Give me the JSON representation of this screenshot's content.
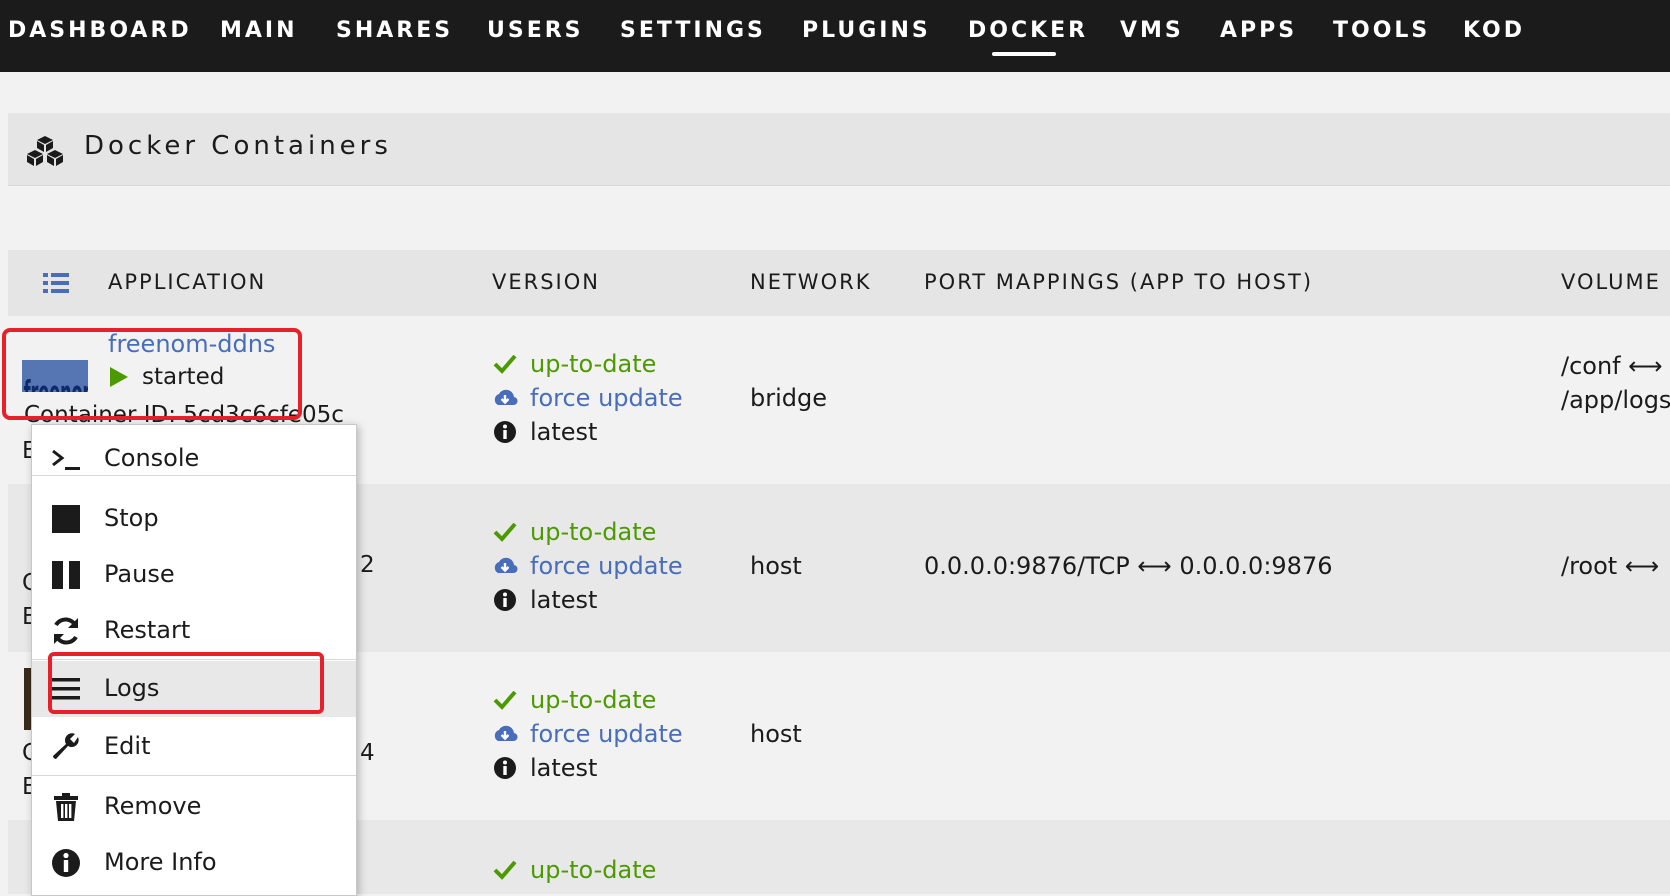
{
  "nav": {
    "items": [
      "DASHBOARD",
      "MAIN",
      "SHARES",
      "USERS",
      "SETTINGS",
      "PLUGINS",
      "DOCKER",
      "VMS",
      "APPS",
      "TOOLS",
      "KOD"
    ],
    "active": "DOCKER"
  },
  "title": "Docker Containers",
  "table": {
    "headers": [
      "APPLICATION",
      "VERSION",
      "NETWORK",
      "PORT MAPPINGS (APP TO HOST)",
      "VOLUME"
    ]
  },
  "rows": [
    {
      "app_name": "freenom-ddns",
      "status": "started",
      "container_id_fragment": "Container ID: 5cd3c6cfe05c",
      "logo_text": "freenom",
      "version": {
        "uptodate": "up-to-date",
        "force": "force update",
        "tag": "latest"
      },
      "network": "bridge",
      "port_mapping": "",
      "volumes": [
        "/conf ⟷",
        "/app/logs"
      ]
    },
    {
      "version": {
        "uptodate": "up-to-date",
        "force": "force update",
        "tag": "latest"
      },
      "network": "host",
      "port_mapping": "0.0.0.0:9876/TCP ⟷ 0.0.0.0:9876",
      "volumes": [
        "/root ⟷"
      ]
    },
    {
      "version": {
        "uptodate": "up-to-date",
        "force": "force update",
        "tag": "latest"
      },
      "network": "host",
      "port_mapping": "",
      "volumes": []
    },
    {
      "version": {
        "uptodate": "up-to-date"
      }
    }
  ],
  "context_menu": {
    "items": [
      "Console",
      "Stop",
      "Pause",
      "Restart",
      "Logs",
      "Edit",
      "Remove",
      "More Info"
    ],
    "highlighted": "Logs"
  },
  "fragments": {
    "b": "E",
    "c": "C",
    "two": "2",
    "four": "4"
  },
  "colors": {
    "nav_bg": "#1c1b1b",
    "green": "#4c9a00",
    "link": "#486dba",
    "highlight": "#e8202a"
  }
}
